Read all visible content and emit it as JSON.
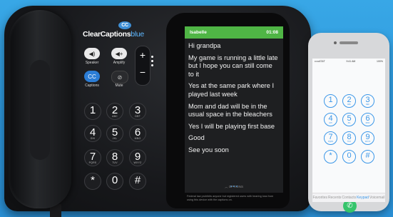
{
  "brand": {
    "name": "ClearCaptions",
    "suffix": "blue",
    "badge": "CC"
  },
  "controls": {
    "speaker": "Speaker",
    "amplify": "Amplify",
    "captions": "Captions",
    "mute": "Mute",
    "volume_up": "+",
    "volume_down": "−"
  },
  "keypad": [
    {
      "d": "1",
      "l": ""
    },
    {
      "d": "2",
      "l": "ABC"
    },
    {
      "d": "3",
      "l": "DEF"
    },
    {
      "d": "4",
      "l": "GHI"
    },
    {
      "d": "5",
      "l": "JKL"
    },
    {
      "d": "6",
      "l": "MNO"
    },
    {
      "d": "7",
      "l": "PQRS"
    },
    {
      "d": "8",
      "l": "TUV"
    },
    {
      "d": "9",
      "l": "WXYZ"
    },
    {
      "d": "*",
      "l": ""
    },
    {
      "d": "0",
      "l": ""
    },
    {
      "d": "#",
      "l": ""
    }
  ],
  "screen": {
    "caller": "Isabelle",
    "time": "01:08",
    "messages": [
      "Hi grandpa",
      "My game is running a little late but I hope you can still come to it",
      "Yes at the same park where I played last week",
      "Mom and dad will be in the usual space in the bleachers",
      "Yes I will be playing first base",
      "Good",
      "See you soon"
    ],
    "options_label": "OPTIONS",
    "disclaimer": "Federal law prohibits anyone but registered users with hearing loss from using this device with the captions on."
  },
  "mobile": {
    "carrier": "•••••AT&T",
    "time": "9:41 AM",
    "battery": "100%",
    "keypad": [
      {
        "d": "1",
        "l": ""
      },
      {
        "d": "2",
        "l": "ABC"
      },
      {
        "d": "3",
        "l": "DEF"
      },
      {
        "d": "4",
        "l": "GHI"
      },
      {
        "d": "5",
        "l": "JKL"
      },
      {
        "d": "6",
        "l": "MNO"
      },
      {
        "d": "7",
        "l": "PQRS"
      },
      {
        "d": "8",
        "l": "TUV"
      },
      {
        "d": "9",
        "l": "WXYZ"
      },
      {
        "d": "*",
        "l": ""
      },
      {
        "d": "0",
        "l": "+"
      },
      {
        "d": "#",
        "l": ""
      }
    ],
    "tabs": [
      "Favorites",
      "Recents",
      "Contacts",
      "Keypad",
      "Voicemail"
    ],
    "active_tab": "Keypad"
  },
  "colors": {
    "background": "#2d97dc",
    "caption_header": "#4fb545",
    "accent": "#3b97e8"
  }
}
